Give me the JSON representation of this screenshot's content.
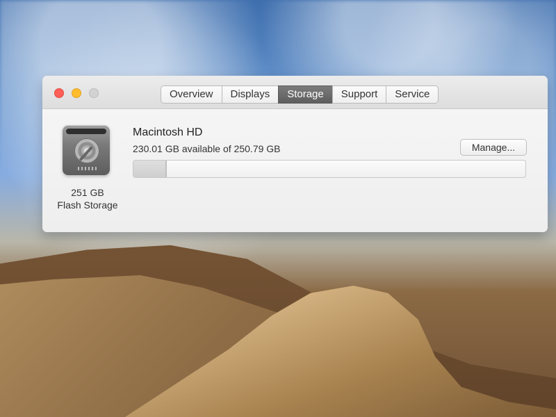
{
  "window": {
    "tabs": [
      {
        "label": "Overview",
        "active": false
      },
      {
        "label": "Displays",
        "active": false
      },
      {
        "label": "Storage",
        "active": true
      },
      {
        "label": "Support",
        "active": false
      },
      {
        "label": "Service",
        "active": false
      }
    ]
  },
  "storage": {
    "volume_name": "Macintosh HD",
    "availability": "230.01 GB available of 250.79 GB",
    "manage_label": "Manage...",
    "drive_size": "251 GB",
    "drive_type": "Flash Storage",
    "used_fraction": 0.082,
    "icons": {
      "close": "close-icon",
      "minimize": "minimize-icon",
      "zoom": "zoom-icon",
      "drive": "hard-drive-icon"
    }
  }
}
